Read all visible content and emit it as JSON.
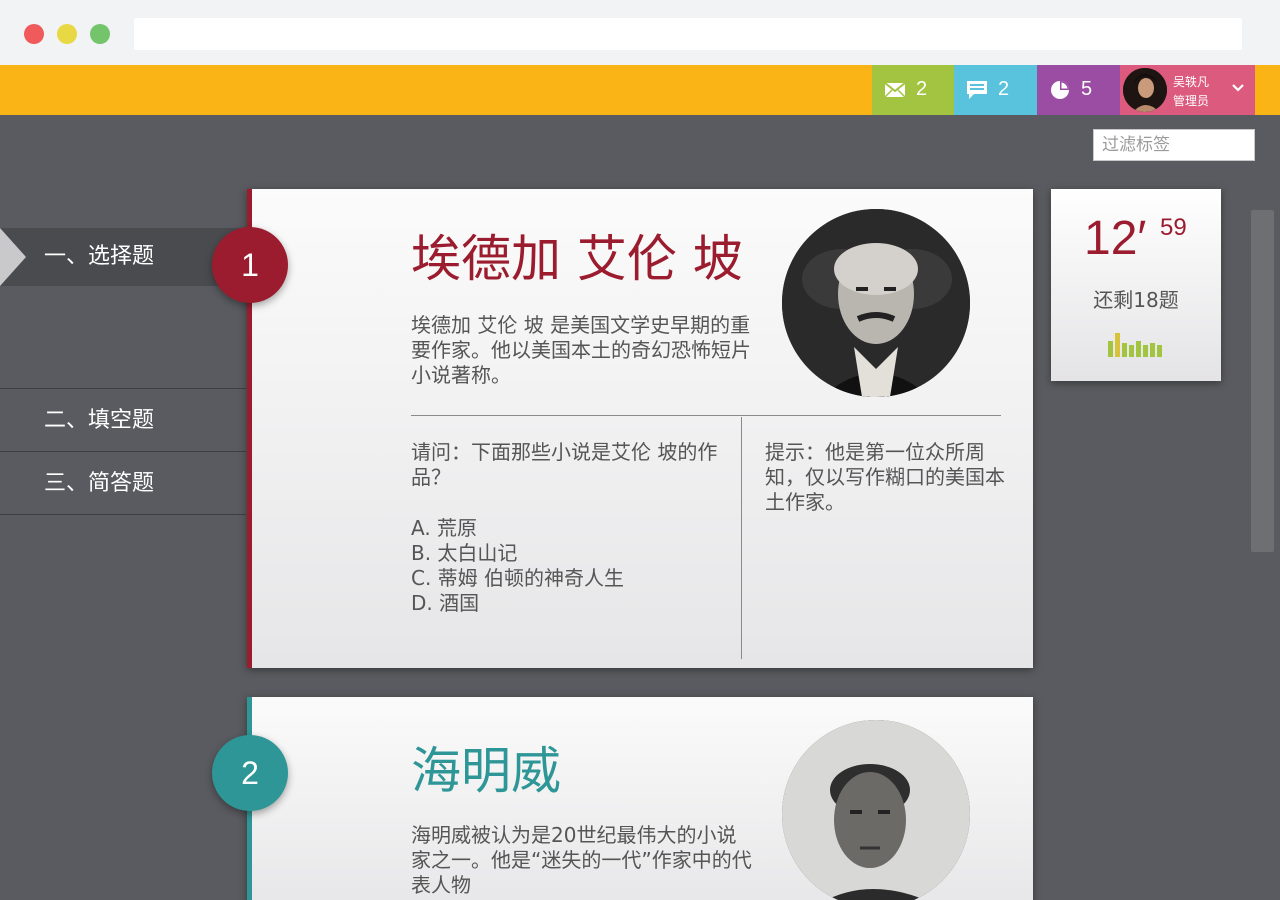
{
  "header": {
    "stats": [
      {
        "icon": "mail-icon",
        "count": "2"
      },
      {
        "icon": "chat-icon",
        "count": "2"
      },
      {
        "icon": "pie-chart-icon",
        "count": "5"
      }
    ],
    "user": {
      "name": "吴轶凡",
      "role": "管理员"
    }
  },
  "filter": {
    "placeholder": "过滤标签"
  },
  "sidebar": {
    "items": [
      {
        "label": "一、选择题",
        "active": true
      },
      {
        "label": "二、填空题",
        "active": false
      },
      {
        "label": "三、简答题",
        "active": false
      }
    ]
  },
  "cards": [
    {
      "number": "1",
      "title": "埃德加 艾伦 坡",
      "desc": "埃德加 艾伦 坡 是美国文学史早期的重要作家。他以美国本土的奇幻恐怖短片小说著称。",
      "question": "请问：下面那些小说是艾伦 坡的作品？",
      "options": [
        "A. 荒原",
        "B. 太白山记",
        "C. 蒂姆 伯顿的神奇人生",
        "D. 酒国"
      ],
      "hint": "提示：他是第一位众所周知，仅以写作糊口的美国本土作家。"
    },
    {
      "number": "2",
      "title": "海明威",
      "desc": "海明威被认为是20世纪最伟大的小说家之一。他是“迷失的一代”作家中的代表人物"
    }
  ],
  "timer": {
    "minutes": "12′",
    "seconds": "59",
    "remaining": "还剩18题"
  },
  "colors": {
    "topbar": "#fbb416",
    "card1_accent": "#9b1c2e",
    "card2_accent": "#2e9696",
    "mail": "#a3c440",
    "chat": "#59c2dc",
    "pie": "#9b4da4",
    "user": "#dc5a7e"
  }
}
